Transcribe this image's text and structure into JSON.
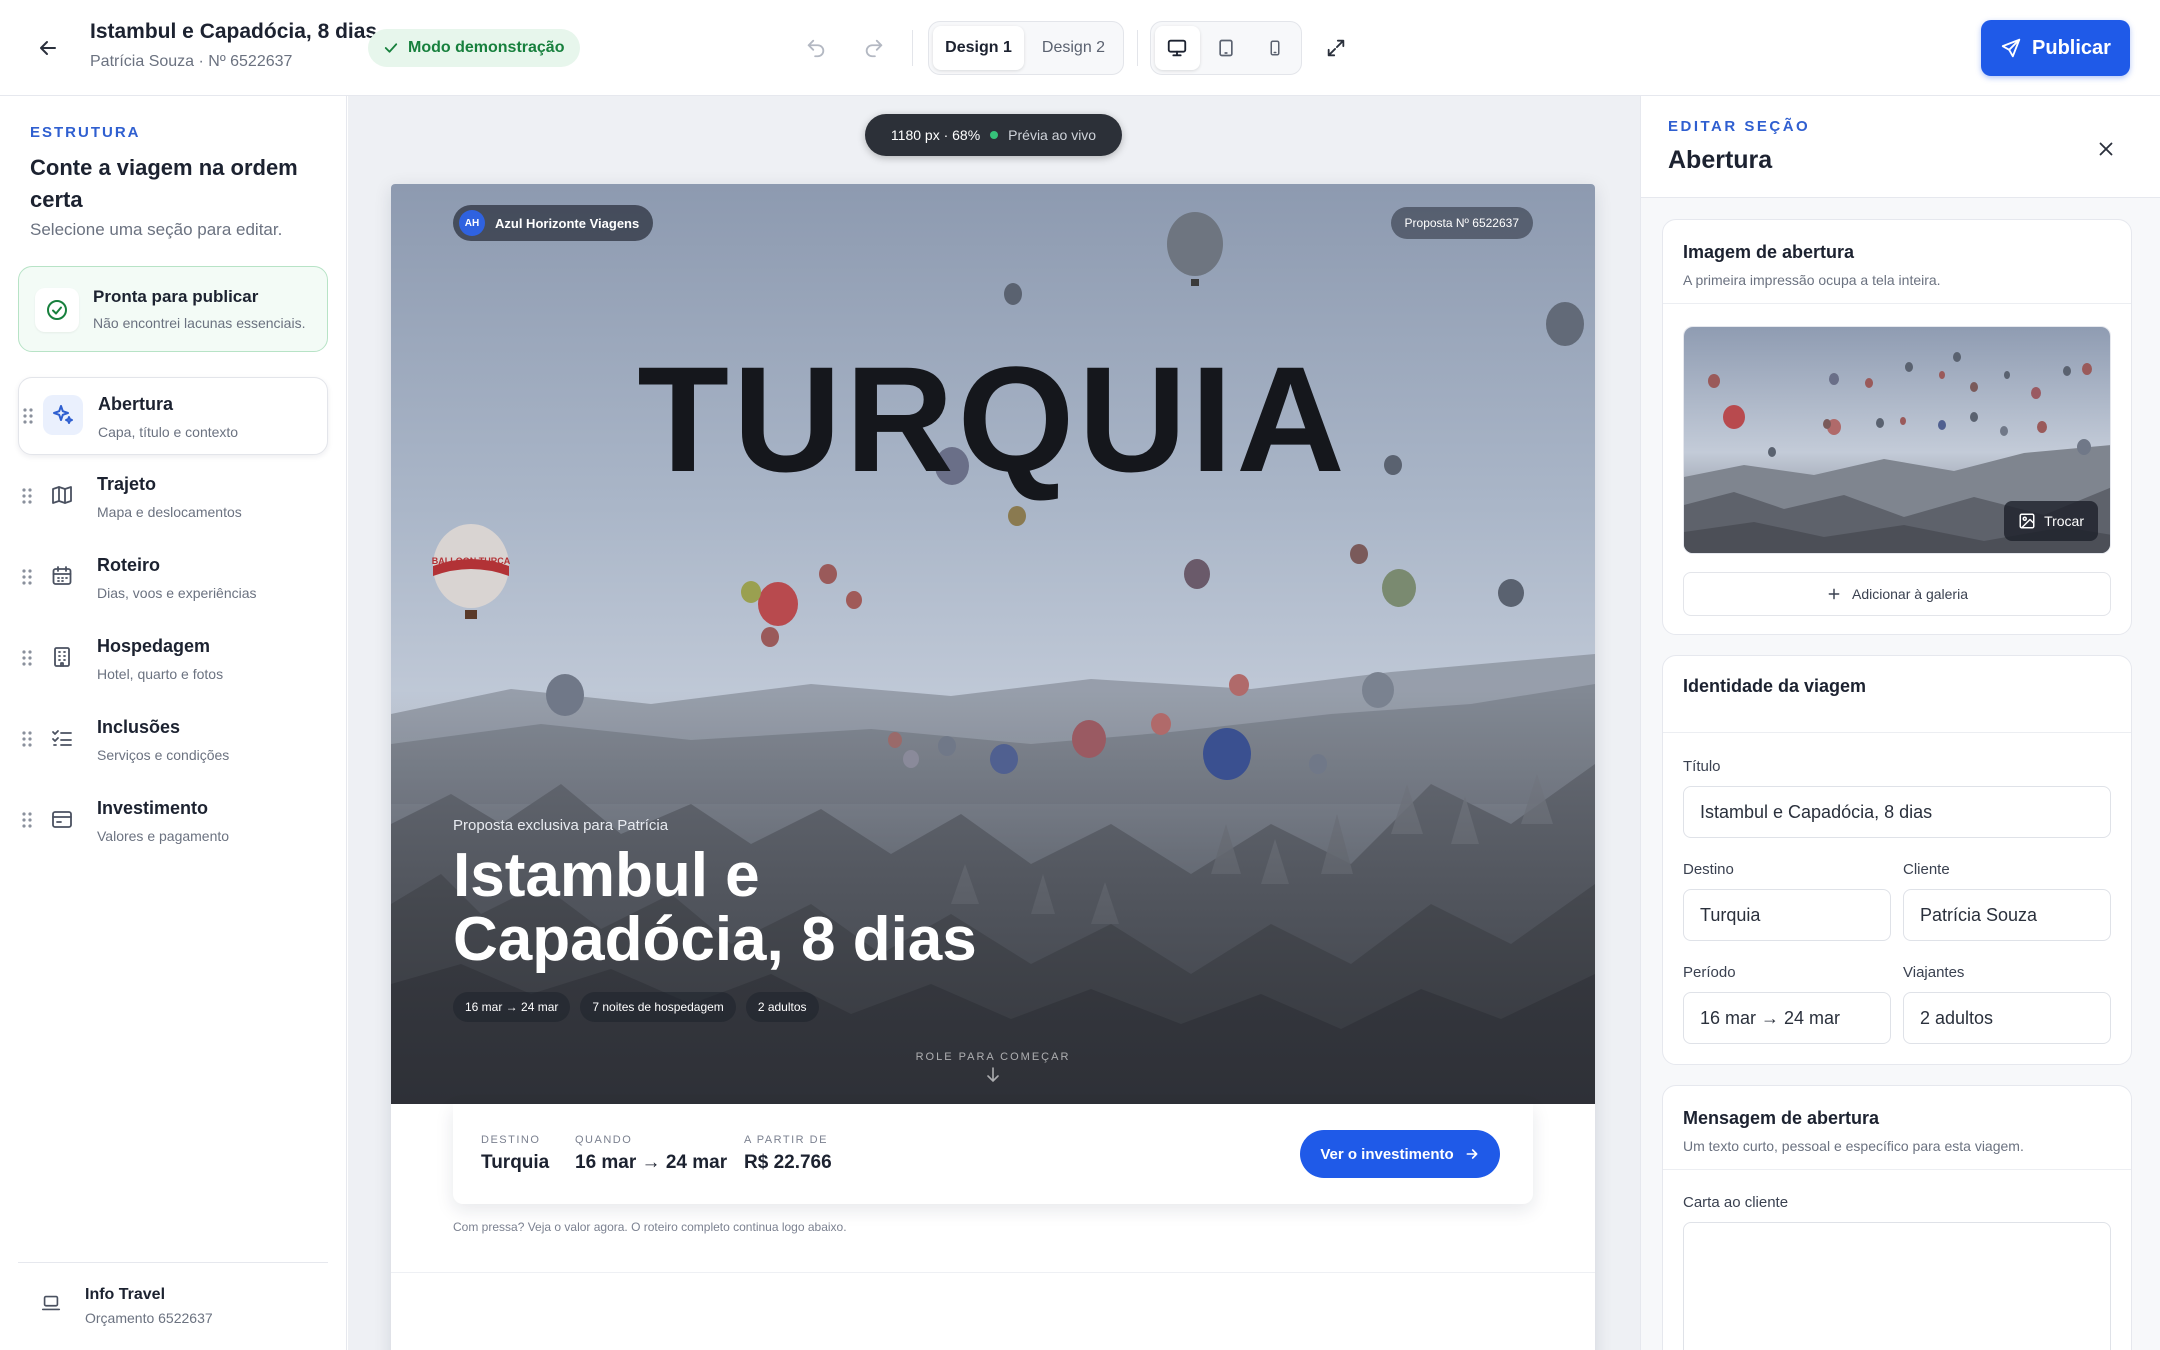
{
  "header": {
    "title": "Istambul e Capadócia, 8 dias",
    "subtitle": "Patrícia Souza · Nº 6522637",
    "demo_badge": "Modo demonstração",
    "design_tabs": [
      "Design 1",
      "Design 2"
    ],
    "active_design": 0,
    "active_device": "desktop",
    "publish_label": "Publicar"
  },
  "sidebar": {
    "eyebrow": "ESTRUTURA",
    "heading": "Conte a viagem na ordem certa",
    "subheading": "Selecione uma seção para editar.",
    "status": {
      "title": "Pronta para publicar",
      "subtitle": "Não encontrei lacunas essenciais."
    },
    "items": [
      {
        "label": "Abertura",
        "desc": "Capa, título e contexto",
        "icon": "sparkles-icon",
        "active": true
      },
      {
        "label": "Trajeto",
        "desc": "Mapa e deslocamentos",
        "icon": "map-icon"
      },
      {
        "label": "Roteiro",
        "desc": "Dias, voos e experiências",
        "icon": "calendar-icon"
      },
      {
        "label": "Hospedagem",
        "desc": "Hotel, quarto e fotos",
        "icon": "building-icon"
      },
      {
        "label": "Inclusões",
        "desc": "Serviços e condições",
        "icon": "checklist-icon"
      },
      {
        "label": "Investimento",
        "desc": "Valores e pagamento",
        "icon": "wallet-icon"
      }
    ],
    "footer": {
      "name": "Info Travel",
      "sub": "Orçamento 6522637"
    }
  },
  "canvas": {
    "preview_size": "1180 px · 68%",
    "preview_live": "Prévia ao vivo",
    "hero": {
      "agency_initials": "AH",
      "agency_name": "Azul Horizonte Viagens",
      "proposal_number": "Proposta Nº 6522637",
      "destination_word": "TURQUIA",
      "kicker": "Proposta exclusiva para Patrícia",
      "title": "Istambul e Capadócia, 8 dias",
      "chips": [
        "16 mar → 24 mar",
        "7 noites de hospedagem",
        "2 adultos"
      ],
      "scroll_cue": "ROLE PARA COMEÇAR",
      "balloon_text": "BALLOON TURCA"
    },
    "summary": {
      "destination_label": "DESTINO",
      "destination_value": "Turquia",
      "when_label": "QUANDO",
      "when_value": "16 mar → 24 mar",
      "price_label": "A PARTIR DE",
      "price_value": "R$ 22.766",
      "cta_label": "Ver o investimento"
    },
    "hurry_note": "Com pressa? Veja o valor agora. O roteiro completo continua logo abaixo."
  },
  "editor": {
    "eyebrow": "EDITAR SEÇÃO",
    "title": "Abertura",
    "cover_image": {
      "title": "Imagem de abertura",
      "subtitle": "A primeira impressão ocupa a tela inteira.",
      "swap_label": "Trocar",
      "gallery_label": "Adicionar à galeria"
    },
    "identity": {
      "title": "Identidade da viagem",
      "fields": {
        "title_label": "Título",
        "title_value": "Istambul e Capadócia, 8 dias",
        "destination_label": "Destino",
        "destination_value": "Turquia",
        "client_label": "Cliente",
        "client_value": "Patrícia Souza",
        "period_label": "Período",
        "period_value": "16 mar → 24 mar",
        "travelers_label": "Viajantes",
        "travelers_value": "2 adultos"
      }
    },
    "message": {
      "title": "Mensagem de abertura",
      "subtitle": "Um texto curto, pessoal e específico para esta viagem.",
      "letter_label": "Carta ao cliente",
      "letter_value": ""
    }
  },
  "colors": {
    "accent": "#1f5ae8",
    "success": "#17803d",
    "eyebrow": "#2f5fd0"
  }
}
